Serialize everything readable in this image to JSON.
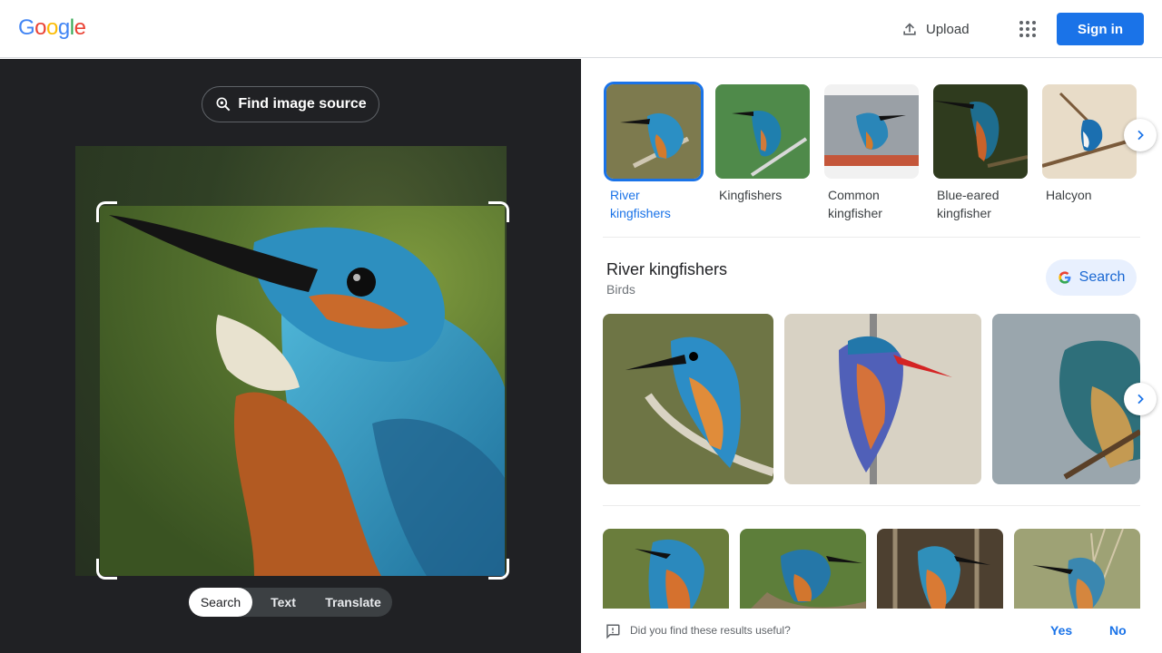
{
  "header": {
    "logo_letters": [
      {
        "ch": "G",
        "color": "#4285F4"
      },
      {
        "ch": "o",
        "color": "#EA4335"
      },
      {
        "ch": "o",
        "color": "#FBBC05"
      },
      {
        "ch": "g",
        "color": "#4285F4"
      },
      {
        "ch": "l",
        "color": "#34A853"
      },
      {
        "ch": "e",
        "color": "#EA4335"
      }
    ],
    "upload_label": "Upload",
    "apps_icon": "apps-grid-icon",
    "signin_label": "Sign in"
  },
  "left": {
    "find_source_label": "Find image source",
    "modes": [
      {
        "label": "Search",
        "active": true
      },
      {
        "label": "Text",
        "active": false
      },
      {
        "label": "Translate",
        "active": false
      }
    ]
  },
  "right": {
    "related": [
      {
        "label": "River kingfishers",
        "selected": true
      },
      {
        "label": "Kingfishers",
        "selected": false
      },
      {
        "label": "Common kingfisher",
        "selected": false
      },
      {
        "label": "Blue-eared kingfisher",
        "selected": false
      },
      {
        "label": "Halcyon",
        "selected": false
      }
    ],
    "kg_title": "River kingfishers",
    "kg_subtitle": "Birds",
    "kg_search_label": "Search",
    "feedback_question": "Did you find these results useful?",
    "feedback_yes": "Yes",
    "feedback_no": "No"
  },
  "colors": {
    "accent": "#1a73e8",
    "dark_panel": "#202124"
  }
}
